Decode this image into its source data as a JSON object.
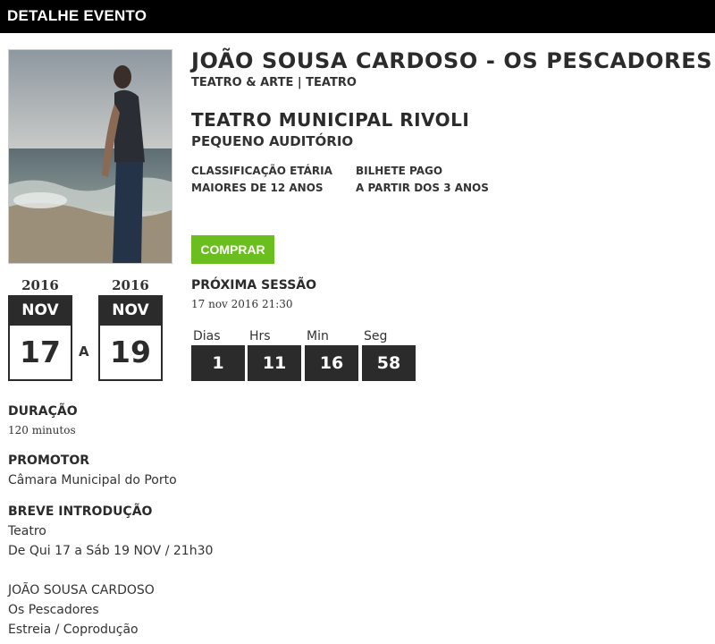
{
  "header": {
    "title": "DETALHE EVENTO"
  },
  "event": {
    "title": "JOÃO SOUSA CARDOSO - OS PESCADORES",
    "category": "TEATRO & ARTE | TEATRO",
    "venue": "TEATRO MUNICIPAL RIVOLI",
    "room": "PEQUENO AUDITÓRIO",
    "rating_label": "CLASSIFICAÇÃO ETÁRIA",
    "rating_value": "MAIORES DE 12 ANOS",
    "ticket_label": "BILHETE PAGO",
    "ticket_value": "A PARTIR DOS 3 ANOS",
    "buy_label": "COMPRAR"
  },
  "dates": {
    "start": {
      "year": "2016",
      "month": "NOV",
      "day": "17"
    },
    "separator": "A",
    "end": {
      "year": "2016",
      "month": "NOV",
      "day": "19"
    }
  },
  "next_session": {
    "label": "PRÓXIMA SESSÃO",
    "datetime": "17 nov 2016 21:30"
  },
  "countdown": {
    "labels": [
      "Dias",
      "Hrs",
      "Min",
      "Seg"
    ],
    "values": [
      "1",
      "11",
      "16",
      "58"
    ]
  },
  "details": {
    "duration_label": "DURAÇÃO",
    "duration_value": "120 minutos",
    "promoter_label": "PROMOTOR",
    "promoter_value": "Câmara Municipal do Porto",
    "intro_label": "BREVE INTRODUÇÃO",
    "intro_lines": [
      "Teatro",
      "De Qui 17 a Sáb 19 NOV / 21h30"
    ],
    "extra_lines": [
      "JOÃO SOUSA CARDOSO",
      "Os Pescadores",
      "Estreia / Coprodução"
    ]
  },
  "colors": {
    "buy_button": "#6abf1e",
    "dark": "#2b2b2b",
    "header_bg": "#000000"
  }
}
